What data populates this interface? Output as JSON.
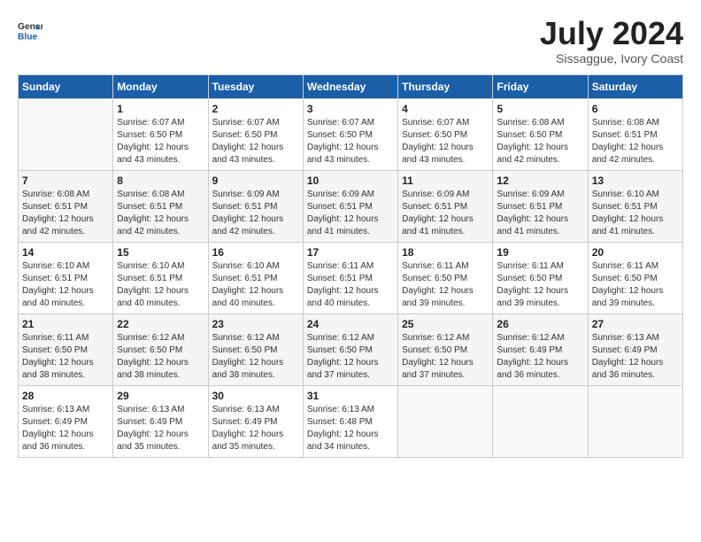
{
  "header": {
    "logo_general": "General",
    "logo_blue": "Blue",
    "month_title": "July 2024",
    "location": "Sissaggue, Ivory Coast"
  },
  "columns": [
    "Sunday",
    "Monday",
    "Tuesday",
    "Wednesday",
    "Thursday",
    "Friday",
    "Saturday"
  ],
  "weeks": [
    [
      {
        "day": "",
        "sunrise": "",
        "sunset": "",
        "daylight": ""
      },
      {
        "day": "1",
        "sunrise": "6:07 AM",
        "sunset": "6:50 PM",
        "daylight": "12 hours and 43 minutes."
      },
      {
        "day": "2",
        "sunrise": "6:07 AM",
        "sunset": "6:50 PM",
        "daylight": "12 hours and 43 minutes."
      },
      {
        "day": "3",
        "sunrise": "6:07 AM",
        "sunset": "6:50 PM",
        "daylight": "12 hours and 43 minutes."
      },
      {
        "day": "4",
        "sunrise": "6:07 AM",
        "sunset": "6:50 PM",
        "daylight": "12 hours and 43 minutes."
      },
      {
        "day": "5",
        "sunrise": "6:08 AM",
        "sunset": "6:50 PM",
        "daylight": "12 hours and 42 minutes."
      },
      {
        "day": "6",
        "sunrise": "6:08 AM",
        "sunset": "6:51 PM",
        "daylight": "12 hours and 42 minutes."
      }
    ],
    [
      {
        "day": "7",
        "sunrise": "6:08 AM",
        "sunset": "6:51 PM",
        "daylight": "12 hours and 42 minutes."
      },
      {
        "day": "8",
        "sunrise": "6:08 AM",
        "sunset": "6:51 PM",
        "daylight": "12 hours and 42 minutes."
      },
      {
        "day": "9",
        "sunrise": "6:09 AM",
        "sunset": "6:51 PM",
        "daylight": "12 hours and 42 minutes."
      },
      {
        "day": "10",
        "sunrise": "6:09 AM",
        "sunset": "6:51 PM",
        "daylight": "12 hours and 41 minutes."
      },
      {
        "day": "11",
        "sunrise": "6:09 AM",
        "sunset": "6:51 PM",
        "daylight": "12 hours and 41 minutes."
      },
      {
        "day": "12",
        "sunrise": "6:09 AM",
        "sunset": "6:51 PM",
        "daylight": "12 hours and 41 minutes."
      },
      {
        "day": "13",
        "sunrise": "6:10 AM",
        "sunset": "6:51 PM",
        "daylight": "12 hours and 41 minutes."
      }
    ],
    [
      {
        "day": "14",
        "sunrise": "6:10 AM",
        "sunset": "6:51 PM",
        "daylight": "12 hours and 40 minutes."
      },
      {
        "day": "15",
        "sunrise": "6:10 AM",
        "sunset": "6:51 PM",
        "daylight": "12 hours and 40 minutes."
      },
      {
        "day": "16",
        "sunrise": "6:10 AM",
        "sunset": "6:51 PM",
        "daylight": "12 hours and 40 minutes."
      },
      {
        "day": "17",
        "sunrise": "6:11 AM",
        "sunset": "6:51 PM",
        "daylight": "12 hours and 40 minutes."
      },
      {
        "day": "18",
        "sunrise": "6:11 AM",
        "sunset": "6:50 PM",
        "daylight": "12 hours and 39 minutes."
      },
      {
        "day": "19",
        "sunrise": "6:11 AM",
        "sunset": "6:50 PM",
        "daylight": "12 hours and 39 minutes."
      },
      {
        "day": "20",
        "sunrise": "6:11 AM",
        "sunset": "6:50 PM",
        "daylight": "12 hours and 39 minutes."
      }
    ],
    [
      {
        "day": "21",
        "sunrise": "6:11 AM",
        "sunset": "6:50 PM",
        "daylight": "12 hours and 38 minutes."
      },
      {
        "day": "22",
        "sunrise": "6:12 AM",
        "sunset": "6:50 PM",
        "daylight": "12 hours and 38 minutes."
      },
      {
        "day": "23",
        "sunrise": "6:12 AM",
        "sunset": "6:50 PM",
        "daylight": "12 hours and 38 minutes."
      },
      {
        "day": "24",
        "sunrise": "6:12 AM",
        "sunset": "6:50 PM",
        "daylight": "12 hours and 37 minutes."
      },
      {
        "day": "25",
        "sunrise": "6:12 AM",
        "sunset": "6:50 PM",
        "daylight": "12 hours and 37 minutes."
      },
      {
        "day": "26",
        "sunrise": "6:12 AM",
        "sunset": "6:49 PM",
        "daylight": "12 hours and 36 minutes."
      },
      {
        "day": "27",
        "sunrise": "6:13 AM",
        "sunset": "6:49 PM",
        "daylight": "12 hours and 36 minutes."
      }
    ],
    [
      {
        "day": "28",
        "sunrise": "6:13 AM",
        "sunset": "6:49 PM",
        "daylight": "12 hours and 36 minutes."
      },
      {
        "day": "29",
        "sunrise": "6:13 AM",
        "sunset": "6:49 PM",
        "daylight": "12 hours and 35 minutes."
      },
      {
        "day": "30",
        "sunrise": "6:13 AM",
        "sunset": "6:49 PM",
        "daylight": "12 hours and 35 minutes."
      },
      {
        "day": "31",
        "sunrise": "6:13 AM",
        "sunset": "6:48 PM",
        "daylight": "12 hours and 34 minutes."
      },
      {
        "day": "",
        "sunrise": "",
        "sunset": "",
        "daylight": ""
      },
      {
        "day": "",
        "sunrise": "",
        "sunset": "",
        "daylight": ""
      },
      {
        "day": "",
        "sunrise": "",
        "sunset": "",
        "daylight": ""
      }
    ]
  ],
  "labels": {
    "sunrise_prefix": "Sunrise: ",
    "sunset_prefix": "Sunset: ",
    "daylight_prefix": "Daylight: "
  }
}
